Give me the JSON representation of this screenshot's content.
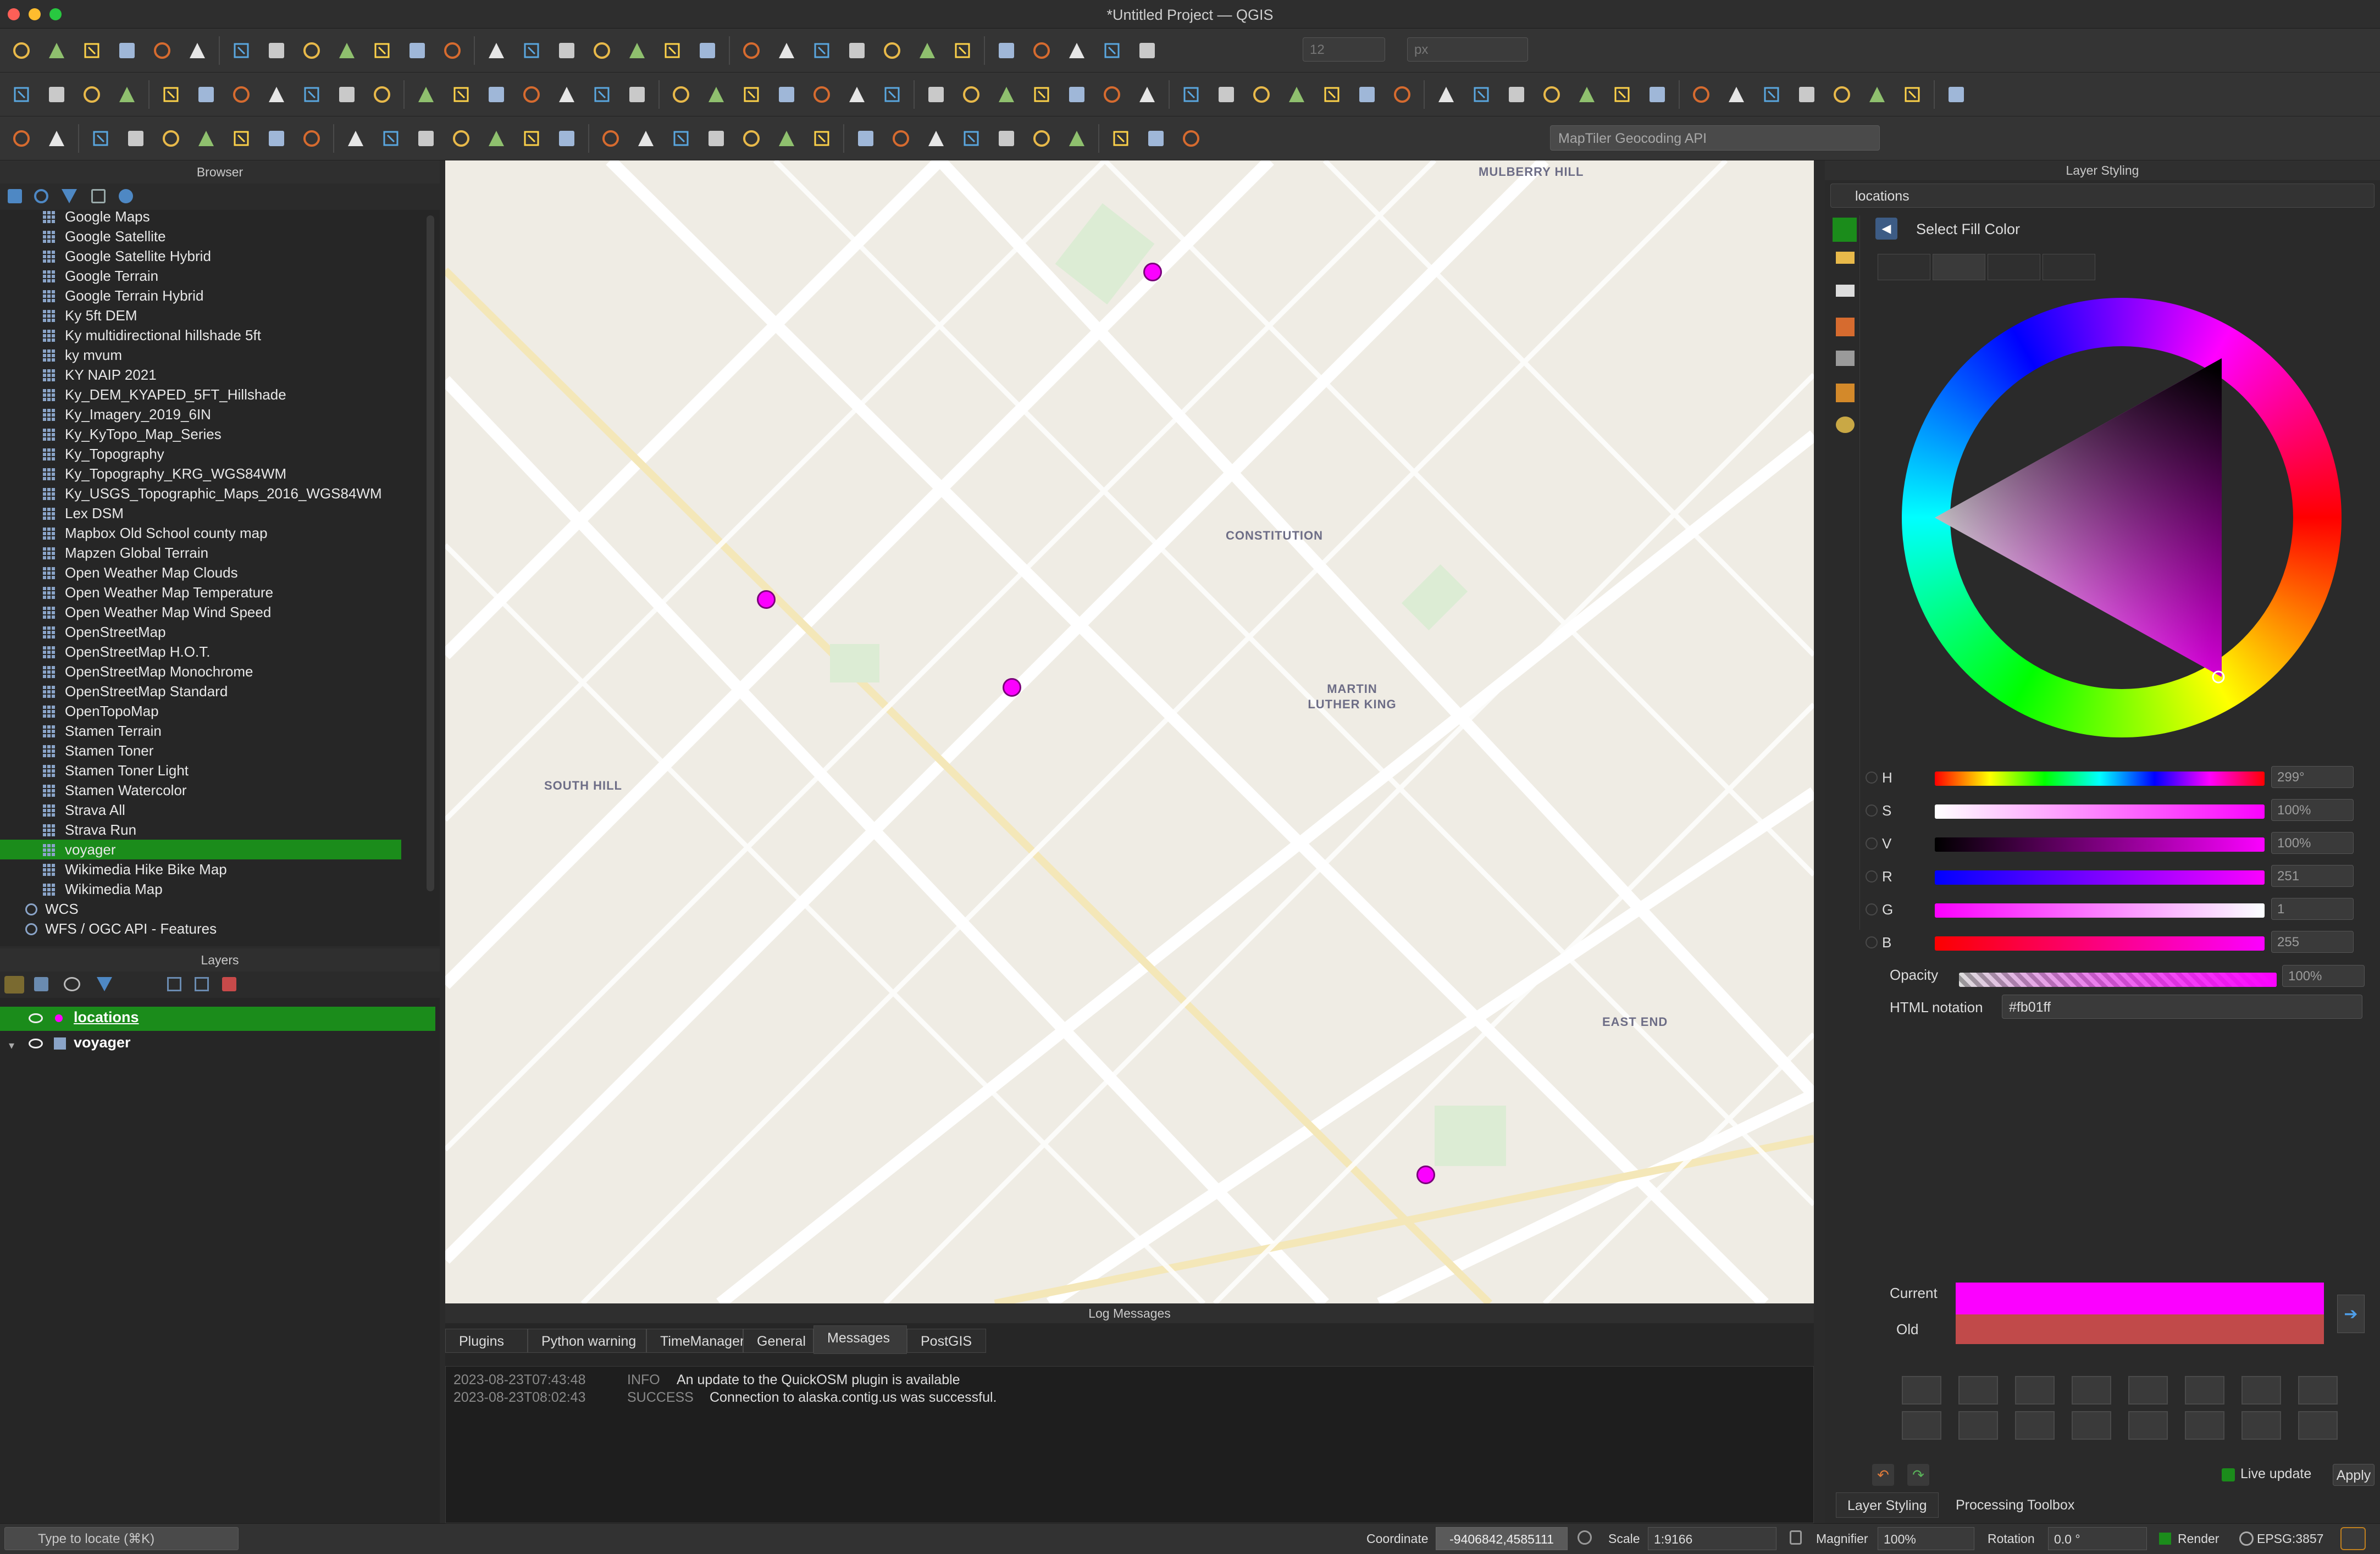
{
  "window": {
    "title": "*Untitled Project — QGIS"
  },
  "toolbar": {
    "zoom_value": "12",
    "zoom_unit": "px",
    "geocoder_placeholder": "MapTiler Geocoding API"
  },
  "browser": {
    "title": "Browser",
    "items": [
      "Google Maps",
      "Google Satellite",
      "Google Satellite Hybrid",
      "Google Terrain",
      "Google Terrain Hybrid",
      "Ky 5ft DEM",
      "Ky multidirectional hillshade 5ft",
      "ky mvum",
      "KY NAIP 2021",
      "Ky_DEM_KYAPED_5FT_Hillshade",
      "Ky_Imagery_2019_6IN",
      "Ky_KyTopo_Map_Series",
      "Ky_Topography",
      "Ky_Topography_KRG_WGS84WM",
      "Ky_USGS_Topographic_Maps_2016_WGS84WM",
      "Lex DSM",
      "Mapbox Old School county map",
      "Mapzen Global Terrain",
      "Open Weather Map Clouds",
      "Open Weather Map Temperature",
      "Open Weather Map Wind Speed",
      "OpenStreetMap",
      "OpenStreetMap H.O.T.",
      "OpenStreetMap Monochrome",
      "OpenStreetMap Standard",
      "OpenTopoMap",
      "Stamen Terrain",
      "Stamen Toner",
      "Stamen Toner Light",
      "Stamen Watercolor",
      "Strava All",
      "Strava Run",
      "voyager",
      "Wikimedia Hike Bike Map",
      "Wikimedia Map"
    ],
    "selected": "voyager",
    "group_wcs": "WCS",
    "group_wfs": "WFS / OGC API - Features"
  },
  "layers": {
    "title": "Layers",
    "items": [
      {
        "name": "locations",
        "selected": true
      },
      {
        "name": "voyager",
        "selected": false
      }
    ]
  },
  "map": {
    "neighborhoods": [
      "MULBERRY HILL",
      "CONSTITUTION",
      "MARTIN LUTHER KING",
      "SOUTH HILL",
      "EAST END"
    ],
    "point_color": "#fb01ff"
  },
  "log": {
    "title": "Log Messages",
    "tabs": [
      "Plugins",
      "Python warning",
      "TimeManager",
      "General",
      "Messages",
      "PostGIS"
    ],
    "active_tab": "Messages",
    "messages": [
      {
        "time": "2023-08-23T07:43:48",
        "level": "INFO",
        "text": "An update to the QuickOSM plugin is available"
      },
      {
        "time": "2023-08-23T08:02:43",
        "level": "SUCCESS",
        "text": "Connection to alaska.contig.us was successful."
      }
    ]
  },
  "styling": {
    "title": "Layer Styling",
    "layer": "locations",
    "section": "Select Fill Color",
    "hsv": [
      {
        "label": "H",
        "value": "299°"
      },
      {
        "label": "S",
        "value": "100%"
      },
      {
        "label": "V",
        "value": "100%"
      },
      {
        "label": "R",
        "value": "251"
      },
      {
        "label": "G",
        "value": "1"
      },
      {
        "label": "B",
        "value": "255"
      }
    ],
    "opacity_label": "Opacity",
    "opacity_value": "100%",
    "html_label": "HTML notation",
    "html_value": "#fb01ff",
    "current_label": "Current",
    "old_label": "Old",
    "current_color": "#fb01ff",
    "old_color": "#c14a4a",
    "live_update": "Live update",
    "apply": "Apply",
    "bottom_tabs": [
      "Layer Styling",
      "Processing Toolbox"
    ]
  },
  "status": {
    "locate_placeholder": "Type to locate (⌘K)",
    "coordinate_label": "Coordinate",
    "coordinate_value": "-9406842,4585111",
    "scale_label": "Scale",
    "scale_value": "1:9166",
    "magnifier_label": "Magnifier",
    "magnifier_value": "100%",
    "rotation_label": "Rotation",
    "rotation_value": "0.0 °",
    "render_label": "Render",
    "crs": "EPSG:3857"
  }
}
